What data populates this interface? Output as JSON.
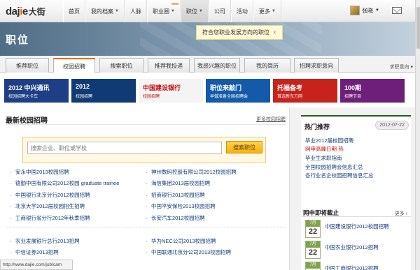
{
  "topbar": {
    "logo": {
      "brand": "dajie",
      "brand_cn": "大街"
    },
    "nav": [
      {
        "label": "首页",
        "caret": false,
        "badge": ""
      },
      {
        "label": "我的档案",
        "caret": true,
        "badge": ""
      },
      {
        "label": "人脉",
        "caret": false,
        "badge": ""
      },
      {
        "label": "职业圈",
        "caret": true,
        "badge": "new"
      },
      {
        "label": "职位",
        "caret": true,
        "badge": ""
      },
      {
        "label": "公司",
        "caret": false,
        "badge": ""
      },
      {
        "label": "活动",
        "caret": false,
        "badge": ""
      },
      {
        "label": "更多",
        "caret": true,
        "badge": ""
      }
    ],
    "user": {
      "name": "张晓"
    }
  },
  "header": {
    "title": "职位",
    "toast": {
      "message": "符合您职业发展方向的职位",
      "close": "×"
    }
  },
  "tabs": {
    "items": [
      "推荐职位",
      "校园招聘",
      "搜索职位",
      "推荐我投递",
      "我感兴趣的职位",
      "我的简历",
      "招聘求职意向"
    ],
    "active_index": 1,
    "more": "求职意向 ▾"
  },
  "banners": [
    {
      "line1": "2012 中兴通讯",
      "line2": "校园招聘大卡车",
      "bg": "#1e3f86"
    },
    {
      "line1": "2012",
      "line2": "校园招聘",
      "bg": "#0f3a73"
    },
    {
      "line1": "中国建设银行",
      "line2": "校园招聘",
      "bg": "#f4f4f4"
    },
    {
      "line1": "职位来敲门",
      "line2": "早做准备全国招聘会",
      "bg": "#155aa8"
    },
    {
      "line1": "托福备考",
      "line2": "首选新东方网",
      "bg": "#c7221c"
    },
    {
      "line1": "100期",
      "line2": "招聘节目",
      "bg": "#6d1f7a"
    }
  ],
  "main": {
    "section_title": "最新校园招聘",
    "section_link": "更多校园招聘",
    "search": {
      "placeholder": "搜索企业、职位或学校",
      "button": "搜索职位"
    },
    "jobs_left": [
      "安永中国2013校园招聘",
      "德勤中国有限公司2012校园 graduate trainee",
      "中国银行北京分行2012校园招聘",
      "北京大学2012届校园招生招聘",
      "工商银行省分行2012年秋季招聘",
      "农业发展银行总行2013招聘",
      "中信证券2013招聘"
    ],
    "jobs_right": [
      "神州数码控股有限公司2012校园招聘",
      "海信集团2013届校园招聘",
      "招商银行2013校园招聘",
      "中国平安保险2013校园招聘",
      "长安汽车2012校园招聘",
      "华为NEC公司2013校园招聘",
      "中国联通北京分公司2013校园招聘"
    ]
  },
  "side": {
    "title": "热门推荐",
    "date": "2012-07-22",
    "items": [
      {
        "text": "毕业2012届校园招聘",
        "red": false
      },
      {
        "text": "网申高峰日期 热",
        "red": true
      },
      {
        "text": "毕业生求职指南",
        "red": false
      },
      {
        "text": "全国校园招聘会信息汇总",
        "red": false
      },
      {
        "text": "各行业名企校园招聘信息汇总",
        "red": false
      }
    ]
  },
  "deadlines": {
    "title": "网申即将截止",
    "more": "更多 ›",
    "items": [
      {
        "month": "7月",
        "day": "22",
        "text": "中国建设银行2012校园招聘"
      },
      {
        "month": "7月",
        "day": "22",
        "text": "中国农业银行2012招聘"
      },
      {
        "month": "7月",
        "day": "22",
        "text": "中国工商银行2012招聘"
      }
    ]
  },
  "status": {
    "text": "http://www.dajie.com/job/cam"
  }
}
